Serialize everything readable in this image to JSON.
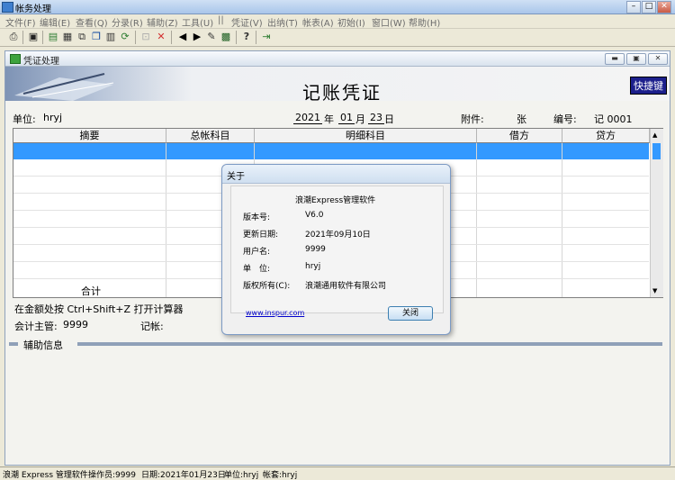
{
  "window": {
    "title": "帐务处理"
  },
  "menu": [
    "文件(F)",
    "编辑(E)",
    "查看(Q)",
    "分录(R)",
    "辅助(Z)",
    "工具(U)",
    "||",
    "凭证(V)",
    "出纳(T)",
    "帐表(A)",
    "初始(I)",
    "窗口(W)",
    "帮助(H)"
  ],
  "toolbar_icons": [
    "print-icon",
    "save-icon",
    "open-icon",
    "list-icon",
    "link-icon",
    "copy-icon",
    "paste-icon",
    "refresh-icon",
    "disabled-icon",
    "delete-icon",
    "prev-icon",
    "next-icon",
    "tool-icon",
    "grid-icon",
    "help-icon",
    "exit-icon"
  ],
  "child": {
    "title": "凭证处理"
  },
  "voucher": {
    "title": "记账凭证",
    "shortcut": "快捷键",
    "unit_label": "单位:",
    "unit_value": "hryj",
    "year": "2021",
    "year_label": "年",
    "month": "01",
    "month_label": "月",
    "day": "23",
    "day_label": "日",
    "attach_label": "附件:",
    "attach_unit": "张",
    "no_label": "编号:",
    "no_value": "记 0001",
    "columns": [
      "摘要",
      "总帐科目",
      "明细科目",
      "借方",
      "贷方"
    ],
    "total_label": "合计",
    "hint": "在金额处按 Ctrl+Shift+Z 打开计算器",
    "supervisor_label": "会计主管:",
    "supervisor_value": "9999",
    "bookkeeper_label": "记帐:",
    "aux_label": "辅助信息"
  },
  "about": {
    "title": "关于",
    "product": "浪潮Express管理软件",
    "version_label": "版本号:",
    "version_value": "V6.0",
    "date_label": "更新日期:",
    "date_value": "2021年09月10日",
    "user_label": "用户名:",
    "user_value": "9999",
    "unit_label": "单　位:",
    "unit_value": "hryj",
    "copyright_label": "版权所有(C):",
    "copyright_value": "浪潮通用软件有限公司",
    "link": "www.inspur.com",
    "close_label": "关闭"
  },
  "status": {
    "product": "浪潮 Express 管理软件",
    "operator": "操作员:9999",
    "date": "日期:2021年01月23日",
    "unit": "单位:hryj",
    "book": "帐套:hryj"
  }
}
